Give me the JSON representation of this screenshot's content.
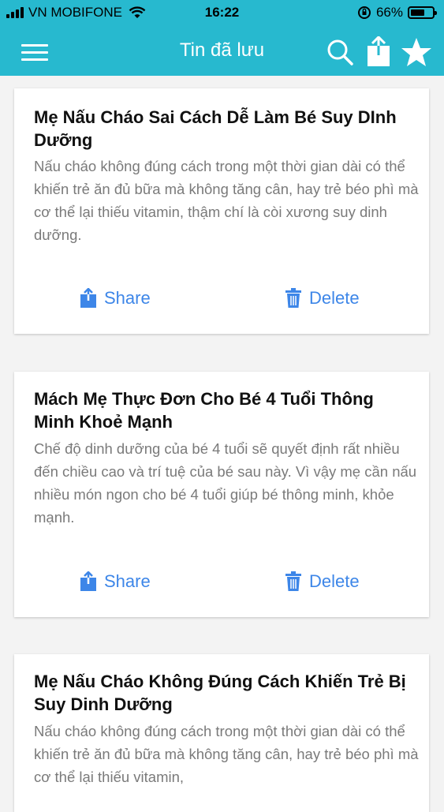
{
  "status_bar": {
    "carrier": "VN MOBIFONE",
    "time": "16:22",
    "battery": "66%",
    "battery_level": 0.66
  },
  "nav": {
    "title": "Tin đã lưu",
    "icons": [
      "menu-icon",
      "search-icon",
      "share-icon",
      "star-icon"
    ]
  },
  "articles": [
    {
      "title": "Mẹ Nấu Cháo Sai Cách Dễ Làm Bé Suy DInh Dưỡng",
      "description": "Nấu cháo không đúng cách trong một thời gian dài có thể khiến trẻ ăn đủ bữa mà không tăng cân, hay trẻ béo phì mà cơ thể lại thiếu vitamin, thậm chí là còi xương suy dinh dưỡng.",
      "share_label": "Share",
      "delete_label": "Delete"
    },
    {
      "title": "Mách Mẹ Thực Đơn Cho Bé 4 Tuổi Thông Minh Khoẻ Mạnh",
      "description": "Chế độ dinh dưỡng của bé 4 tuổi sẽ quyết định rất nhiều đến chiều cao và trí tuệ của bé sau này. Vì vậy mẹ cần nấu nhiều món ngon cho bé 4 tuổi giúp bé thông minh, khỏe mạnh.",
      "share_label": "Share",
      "delete_label": "Delete"
    },
    {
      "title": "Mẹ Nấu Cháo Không Đúng Cách Khiến Trẻ Bị Suy Dinh Dưỡng",
      "description": "Nấu cháo không đúng cách trong một thời gian dài có thể khiến trẻ ăn đủ bữa mà không tăng cân, hay trẻ béo phì mà cơ thể lại thiếu vitamin,"
    }
  ],
  "colors": {
    "header": "#27b9cf",
    "action": "#3d86e8",
    "description": "#7a7a7a"
  }
}
